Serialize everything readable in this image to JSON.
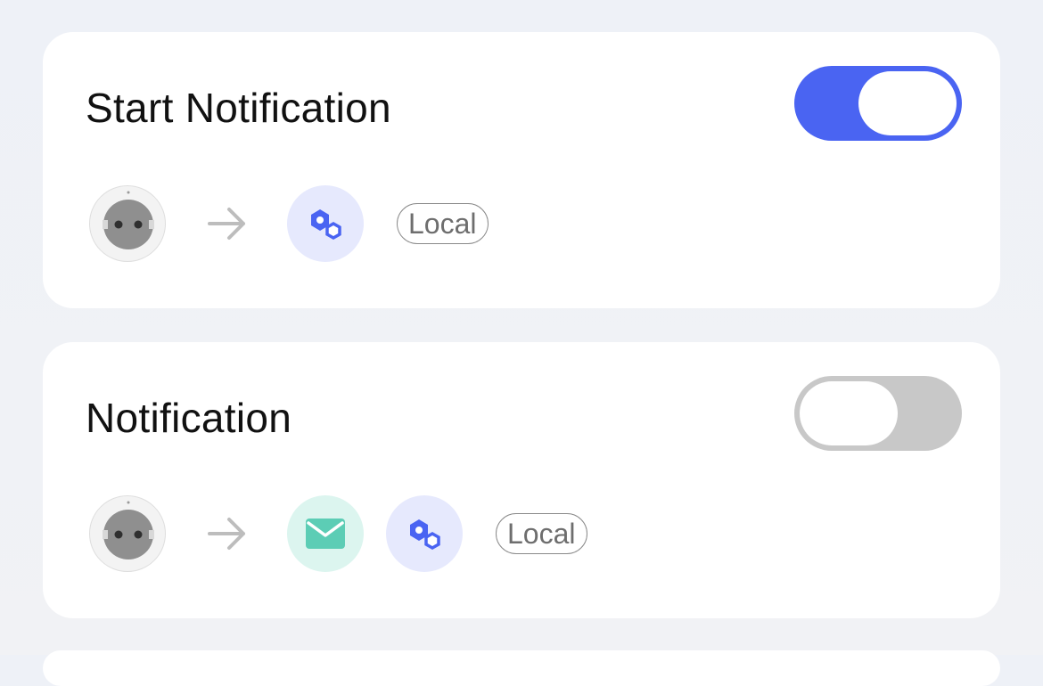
{
  "automations": [
    {
      "title": "Start Notification",
      "enabled": true,
      "trigger_icon": "smart-plug-icon",
      "actions": [
        "hub-icon"
      ],
      "scope_label": "Local"
    },
    {
      "title": "Notification",
      "enabled": false,
      "trigger_icon": "smart-plug-icon",
      "actions": [
        "mail-icon",
        "hub-icon"
      ],
      "scope_label": "Local"
    }
  ],
  "colors": {
    "accent": "#4a64f2",
    "toggle_off": "#c8c8c8",
    "mail": "#5ccdb5"
  }
}
